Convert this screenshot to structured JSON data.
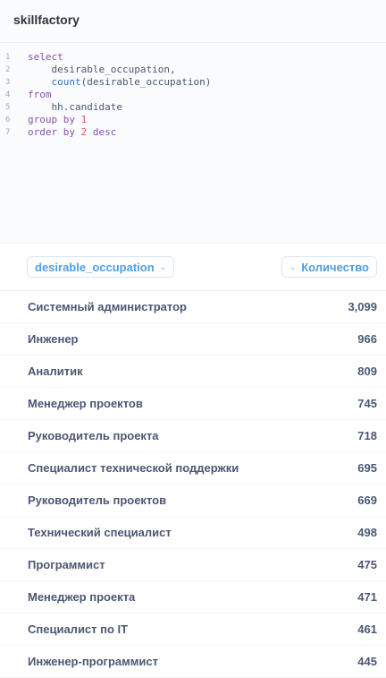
{
  "header": {
    "title": "skillfactory"
  },
  "editor": {
    "lines": [
      {
        "n": "1",
        "parts": [
          {
            "c": "kw",
            "t": "select"
          }
        ]
      },
      {
        "n": "2",
        "parts": [
          {
            "c": "",
            "t": "    desirable_occupation,"
          }
        ]
      },
      {
        "n": "3",
        "parts": [
          {
            "c": "",
            "t": "    "
          },
          {
            "c": "fn",
            "t": "count"
          },
          {
            "c": "",
            "t": "(desirable_occupation)"
          }
        ]
      },
      {
        "n": "4",
        "parts": [
          {
            "c": "kw",
            "t": "from"
          }
        ]
      },
      {
        "n": "5",
        "parts": [
          {
            "c": "",
            "t": "    hh.candidate"
          }
        ]
      },
      {
        "n": "6",
        "parts": [
          {
            "c": "kw",
            "t": "group by "
          },
          {
            "c": "num",
            "t": "1"
          }
        ]
      },
      {
        "n": "7",
        "parts": [
          {
            "c": "kw",
            "t": "order by "
          },
          {
            "c": "num",
            "t": "2"
          },
          {
            "c": "kw",
            "t": " desc"
          }
        ]
      }
    ]
  },
  "table": {
    "columns": [
      "desirable_occupation",
      "Количество"
    ],
    "rows": [
      [
        "Системный администратор",
        "3,099"
      ],
      [
        "Инженер",
        "966"
      ],
      [
        "Аналитик",
        "809"
      ],
      [
        "Менеджер проектов",
        "745"
      ],
      [
        "Руководитель проекта",
        "718"
      ],
      [
        "Специалист технической поддержки",
        "695"
      ],
      [
        "Руководитель проектов",
        "669"
      ],
      [
        "Технический специалист",
        "498"
      ],
      [
        "Программист",
        "475"
      ],
      [
        "Менеджер проекта",
        "471"
      ],
      [
        "Специалист по IT",
        "461"
      ],
      [
        "Инженер-программист",
        "445"
      ]
    ]
  }
}
